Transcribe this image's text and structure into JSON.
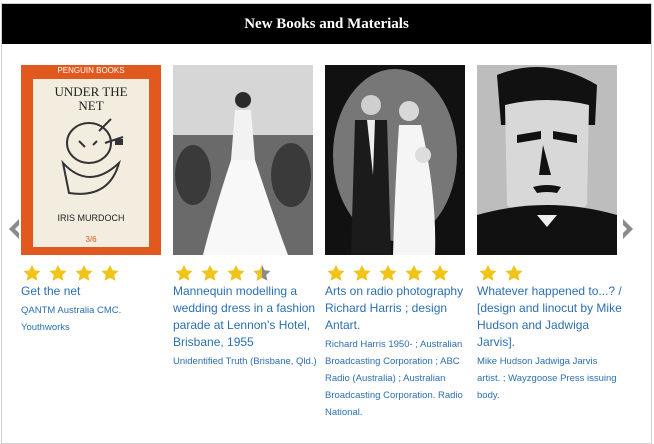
{
  "header": {
    "title": "New Books and Materials"
  },
  "colors": {
    "header_bg": "#000000",
    "link": "#2b6fb0",
    "star": "#f0c419",
    "star_empty": "#8a8a8a",
    "penguin_orange": "#e2591f"
  },
  "carousel": {
    "prev_icon": "chevron-left-icon",
    "next_icon": "chevron-right-icon",
    "items": [
      {
        "cover_title": "UNDER THE NET",
        "cover_publisher": "PENGUIN BOOKS",
        "cover_author": "IRIS MURDOCH",
        "cover_price": "3/6",
        "rating": 4,
        "title": "Get the net",
        "author": "QANTM Australia CMC. Youthworks"
      },
      {
        "rating": 3.5,
        "title": "Mannequin modelling a wedding dress in a fashion parade at Lennon's Hotel, Brisbane, 1955",
        "author": "Unidentified Truth (Brisbane, Qld.)"
      },
      {
        "rating": 5,
        "title": "Arts on radio photography Richard Harris ; design Antart.",
        "author": "Richard Harris 1950- ; Australian Broadcasting Corporation ; ABC Radio (Australia) ; Australian Broadcasting Corporation. Radio National."
      },
      {
        "rating": 2,
        "title": "Whatever happened to...? / [design and linocut by Mike Hudson and Jadwiga Jarvis].",
        "author": "Mike Hudson Jadwiga Jarvis artist. ; Wayzgoose Press issuing body."
      }
    ]
  }
}
